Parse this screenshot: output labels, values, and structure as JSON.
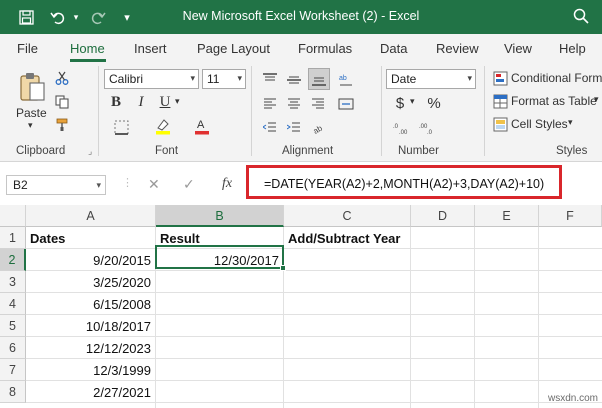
{
  "window": {
    "title": "New Microsoft Excel Worksheet (2)  -  Excel"
  },
  "quick_access": {
    "icons": [
      "save-icon",
      "undo-icon",
      "redo-icon",
      "customize-icon"
    ],
    "search_icon": "search-icon"
  },
  "tabs": [
    {
      "label": "File",
      "active": false
    },
    {
      "label": "Home",
      "active": true
    },
    {
      "label": "Insert",
      "active": false
    },
    {
      "label": "Page Layout",
      "active": false
    },
    {
      "label": "Formulas",
      "active": false
    },
    {
      "label": "Data",
      "active": false
    },
    {
      "label": "Review",
      "active": false
    },
    {
      "label": "View",
      "active": false
    },
    {
      "label": "Help",
      "active": false
    }
  ],
  "ribbon": {
    "clipboard": {
      "label": "Clipboard",
      "paste_label": "Paste"
    },
    "font": {
      "label": "Font",
      "name": "Calibri",
      "size": "11",
      "bold": "B",
      "italic": "I",
      "underline": "U",
      "highlight_color": "#ffff00",
      "font_color": "#e03131"
    },
    "alignment": {
      "label": "Alignment"
    },
    "number": {
      "label": "Number",
      "format": "Date",
      "currency": "$",
      "percent": "%"
    },
    "styles": {
      "label": "Styles",
      "conditional": "Conditional Form",
      "format_table": "Format as Table",
      "cell_styles": "Cell Styles"
    }
  },
  "formula_bar": {
    "name_box": "B2",
    "fx": "fx",
    "formula": "=DATE(YEAR(A2)+2,MONTH(A2)+3,DAY(A2)+10)",
    "highlight_color": "#d9262b"
  },
  "sheet": {
    "columns": [
      "A",
      "B",
      "C",
      "D",
      "E",
      "F"
    ],
    "selected_column": "B",
    "rows": [
      "1",
      "2",
      "3",
      "4",
      "5",
      "6",
      "7",
      "8"
    ],
    "selected_row": "2",
    "headers": {
      "A": "Dates",
      "B": "Result",
      "C": "Add/Subtract Year"
    },
    "dates": [
      "9/20/2015",
      "3/25/2020",
      "6/15/2008",
      "10/18/2017",
      "12/12/2023",
      "12/3/1999",
      "2/27/2021"
    ],
    "result_b2": "12/30/2017",
    "active_cell": "B2",
    "accent_color": "#217346"
  },
  "watermark": "wsxdn.com"
}
